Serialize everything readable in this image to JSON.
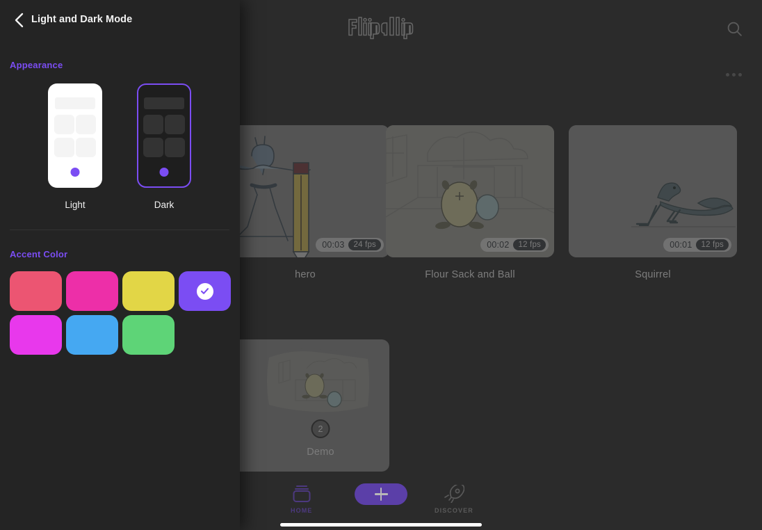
{
  "panel": {
    "title": "Light and Dark Mode",
    "back_icon": "chevron-left-icon",
    "appearance": {
      "label": "Appearance",
      "options": [
        {
          "name": "Light",
          "selected": false
        },
        {
          "name": "Dark",
          "selected": true
        }
      ]
    },
    "accent": {
      "label": "Accent Color",
      "selected_index": 3,
      "colors": [
        "#ec5572",
        "#ed2fa8",
        "#e2d646",
        "#7b4df3",
        "#e838ec",
        "#45a8f2",
        "#5ed477"
      ]
    },
    "accent_active": "#7b4df3"
  },
  "app": {
    "logo_text": "FlipaClip",
    "search_icon": "search-icon",
    "overflow_icon": "more-options-icon",
    "projects_row1": [
      {
        "title": "hero",
        "duration": "00:03",
        "fps": "24 fps"
      },
      {
        "title": "Flour Sack and Ball",
        "duration": "00:02",
        "fps": "12 fps"
      },
      {
        "title": "Squirrel",
        "duration": "00:01",
        "fps": "12 fps"
      }
    ],
    "projects_row2": [
      {
        "title": "Demo",
        "count": "2"
      }
    ],
    "nav": {
      "home_label": "HOME",
      "home_icon": "stacked-cards-icon",
      "add_icon": "plus-icon",
      "discover_label": "DISCOVER",
      "discover_icon": "rocket-icon"
    }
  }
}
